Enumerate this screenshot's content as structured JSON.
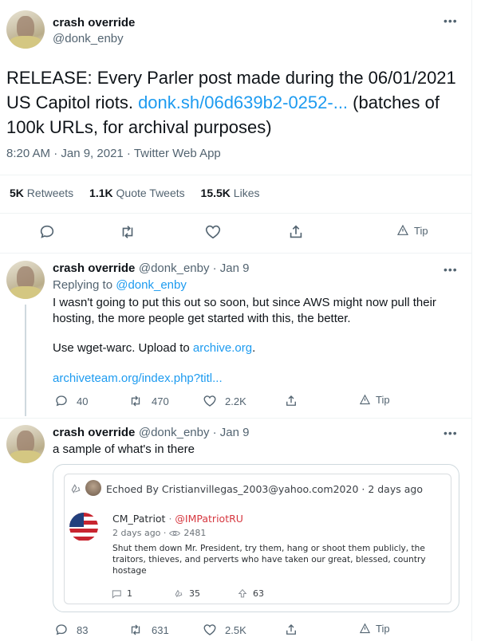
{
  "main_tweet": {
    "name": "crash override",
    "handle": "@donk_enby",
    "text_before": "RELEASE: Every Parler post made during the 06/01/2021 US Capitol riots. ",
    "link": "donk.sh/06d639b2-0252-...",
    "text_after": " (batches of 100k URLs, for archival purposes)",
    "timestamp": "8:20 AM · Jan 9, 2021 · Twitter Web App",
    "stats": {
      "retweets_count": "5K",
      "retweets_label": "Retweets",
      "quotes_count": "1.1K",
      "quotes_label": "Quote Tweets",
      "likes_count": "15.5K",
      "likes_label": "Likes"
    },
    "tip_label": "Tip"
  },
  "reply1": {
    "name": "crash override",
    "handle_date": "@donk_enby · Jan 9",
    "replying_prefix": "Replying to ",
    "replying_to": "@donk_enby",
    "line1": "I wasn't going to put this out so soon, but since AWS might now pull their hosting, the more people get started with this, the better.",
    "line2_prefix": "Use wget-warc. Upload to ",
    "line2_link": "archive.org",
    "line2_suffix": ".",
    "link3": "archiveteam.org/index.php?titl...",
    "replies": "40",
    "retweets": "470",
    "likes": "2.2K",
    "tip_label": "Tip"
  },
  "reply2": {
    "name": "crash override",
    "handle_date": "@donk_enby · Jan 9",
    "text": "a sample of what's in there",
    "replies": "83",
    "retweets": "631",
    "likes": "2.5K",
    "tip_label": "Tip",
    "embedded": {
      "echoed_by": "Echoed By Cristianvillegas_2003@yahoo.com2020 · 2 days ago",
      "author": "CM_Patriot",
      "author_handle": "@IMPatriotRU",
      "meta_time": "2 days ago ·",
      "views": "2481",
      "body": "Shut them down Mr. President, try them, hang or shoot them publicly, the traitors, thieves, and perverts who have taken our great, blessed, country hostage",
      "comments": "1",
      "echoes": "35",
      "upvotes": "63"
    }
  },
  "colors": {
    "accent": "#1d9bf0",
    "muted": "#536471",
    "border": "#eff3f4",
    "parler_red": "#d6373f"
  }
}
